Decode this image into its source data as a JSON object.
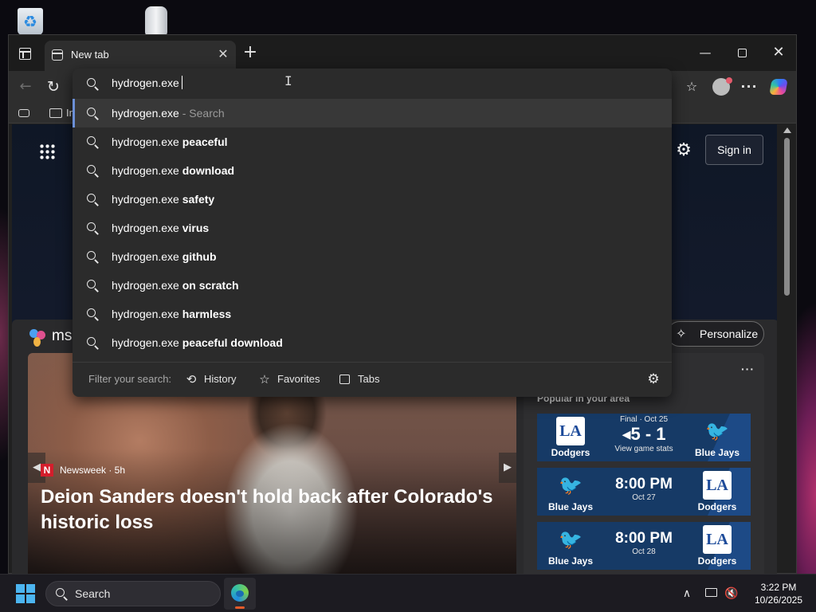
{
  "browser": {
    "tab_title": "New tab",
    "close_tab_glyph": "✕",
    "new_tab_glyph": "+",
    "window_controls": {
      "minimize": "—",
      "close": "✕"
    },
    "nav": {
      "back": "←",
      "refresh": "↻"
    },
    "toolbar_icons": {
      "favorites": "☆",
      "more": "···"
    },
    "favorites_bar": {
      "folder_label": "In"
    },
    "accent": "#6b8fd6"
  },
  "omnibox": {
    "value": "hydrogen.exe",
    "suggestions": [
      {
        "query": "hydrogen.exe",
        "suffix": "",
        "hint": " - Search"
      },
      {
        "query": "hydrogen.exe ",
        "suffix": "peaceful",
        "hint": ""
      },
      {
        "query": "hydrogen.exe ",
        "suffix": "download",
        "hint": ""
      },
      {
        "query": "hydrogen.exe ",
        "suffix": "safety",
        "hint": ""
      },
      {
        "query": "hydrogen.exe ",
        "suffix": "virus",
        "hint": ""
      },
      {
        "query": "hydrogen.exe ",
        "suffix": "github",
        "hint": ""
      },
      {
        "query": "hydrogen.exe ",
        "suffix": "on scratch",
        "hint": ""
      },
      {
        "query": "hydrogen.exe ",
        "suffix": "harmless",
        "hint": ""
      },
      {
        "query": "hydrogen.exe ",
        "suffix": "peaceful download",
        "hint": ""
      }
    ],
    "filter": {
      "label": "Filter your search:",
      "history": "History",
      "favorites": "Favorites",
      "tabs": "Tabs"
    },
    "icons": {
      "history": "⟲",
      "favorites": "☆",
      "settings": "⚙"
    }
  },
  "ntp": {
    "sign_in": "Sign in",
    "settings_icon": "⚙",
    "brand_text": "ms",
    "personalize": "Personalize",
    "personalize_icon": "✧",
    "hero": {
      "source_logo": "N",
      "source": "Newsweek · 5h",
      "headline": "Deion Sanders doesn't hold back after Colorado's historic loss",
      "prev": "◀",
      "next": "▶"
    },
    "sports": {
      "more": "···",
      "title": "Popular in your area",
      "games": [
        {
          "left_team": "Dodgers",
          "left_logo": "LA",
          "status": "Final · Oct 25",
          "score": "◂5 - 1",
          "sub": "View game stats",
          "right_team": "Blue Jays",
          "right_logo": "🐦"
        },
        {
          "left_team": "Blue Jays",
          "left_logo": "🐦",
          "status": "",
          "time": "8:00 PM",
          "sub": "Oct 27",
          "right_team": "Dodgers",
          "right_logo": "LA"
        },
        {
          "left_team": "Blue Jays",
          "left_logo": "🐦",
          "status": "",
          "time": "8:00 PM",
          "sub": "Oct 28",
          "right_team": "Dodgers",
          "right_logo": "LA"
        }
      ]
    }
  },
  "taskbar": {
    "search_label": "Search",
    "clock_time": "3:22 PM",
    "clock_date": "10/26/2025",
    "tray_chevron": "∧",
    "sound_icon": "🔇"
  }
}
